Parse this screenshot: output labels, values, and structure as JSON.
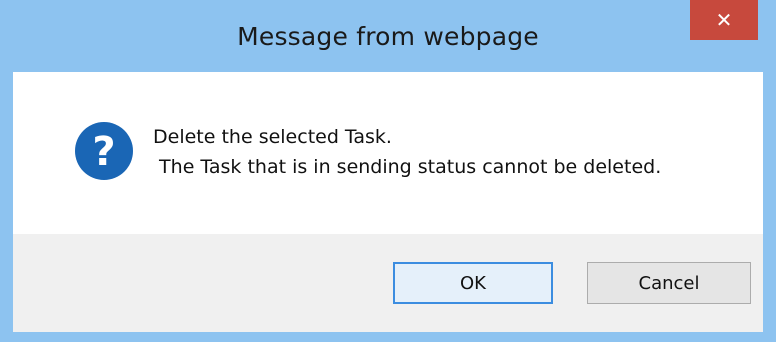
{
  "dialog": {
    "title": "Message from webpage",
    "close_label": "✕",
    "message_line1": "Delete the selected Task.",
    "message_line2": " The Task that is in sending status cannot be deleted.",
    "icon": "question-icon"
  },
  "buttons": {
    "ok_label": "OK",
    "cancel_label": "Cancel"
  },
  "colors": {
    "frame": "#8dc3f0",
    "close": "#c7493d",
    "icon": "#1a66b5",
    "footer": "#f0f0f0",
    "ok_border": "#3c8de0"
  }
}
